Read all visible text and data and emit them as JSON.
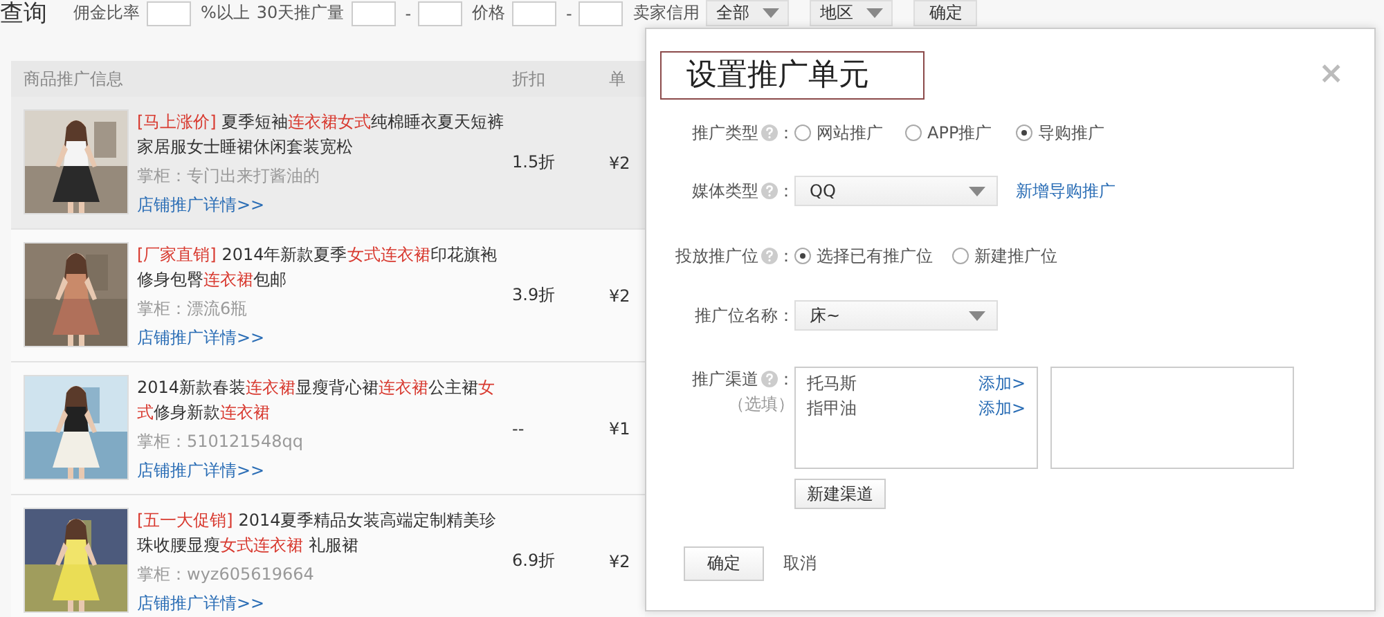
{
  "filter_bar": [
    {
      "kind": "heading",
      "text": "查询"
    },
    {
      "kind": "label",
      "text": "佣金比率"
    },
    {
      "kind": "input"
    },
    {
      "kind": "label",
      "text": "%以上"
    },
    {
      "kind": "label",
      "text": "30天推广量"
    },
    {
      "kind": "input"
    },
    {
      "kind": "label",
      "text": "-"
    },
    {
      "kind": "input"
    },
    {
      "kind": "label",
      "text": "价格"
    },
    {
      "kind": "input"
    },
    {
      "kind": "label",
      "text": "-"
    },
    {
      "kind": "input"
    },
    {
      "kind": "label",
      "text": "卖家信用"
    },
    {
      "kind": "dropdown",
      "value": "全部"
    },
    {
      "kind": "dropdown",
      "value": "地区"
    },
    {
      "kind": "button",
      "text": "确定"
    }
  ],
  "table": {
    "columns": [
      "商品推广信息",
      "折扣",
      "单"
    ],
    "rows": [
      {
        "highlighted": true,
        "tag": "[马上涨价]",
        "title": [
          {
            "text": "夏季短袖",
            "highlight": false
          },
          {
            "text": "连衣裙女式",
            "highlight": true
          },
          {
            "text": "纯棉睡衣夏天短裤家居服女士睡裙休闲套装宽松",
            "highlight": false
          }
        ],
        "shopkeeper": "掌柜：专门出来打酱油的",
        "link": "店铺推广详情>>",
        "discount": "1.5折",
        "price": "¥2"
      },
      {
        "highlighted": false,
        "tag": "[厂家直销]",
        "title": [
          {
            "text": "2014年新款夏季",
            "highlight": false
          },
          {
            "text": "女式连衣裙",
            "highlight": true
          },
          {
            "text": "印花旗袍修身包臀",
            "highlight": false
          },
          {
            "text": "连衣裙",
            "highlight": true
          },
          {
            "text": "包邮",
            "highlight": false
          }
        ],
        "shopkeeper": "掌柜：漂流6瓶",
        "link": "店铺推广详情>>",
        "discount": "3.9折",
        "price": "¥2"
      },
      {
        "highlighted": false,
        "title": [
          {
            "text": "2014新款春装",
            "highlight": false
          },
          {
            "text": "连衣裙",
            "highlight": true
          },
          {
            "text": "显瘦背心裙",
            "highlight": false
          },
          {
            "text": "连衣裙",
            "highlight": true
          },
          {
            "text": "公主裙",
            "highlight": false
          },
          {
            "text": "女式",
            "highlight": true
          },
          {
            "text": "修身新款",
            "highlight": false
          },
          {
            "text": "连衣裙",
            "highlight": true
          }
        ],
        "shopkeeper": "掌柜：510121548qq",
        "link": "店铺推广详情>>",
        "discount": "--",
        "price": "¥1"
      },
      {
        "highlighted": false,
        "tag": "[五一大促销]",
        "title": [
          {
            "text": "2014夏季精品女装高端定制精美珍珠收腰显瘦",
            "highlight": false
          },
          {
            "text": "女式连衣裙",
            "highlight": true
          },
          {
            "text": " 礼服裙",
            "highlight": false
          }
        ],
        "shopkeeper": "掌柜：wyz605619664",
        "link": "店铺推广详情>>",
        "discount": "6.9折",
        "price": "¥2"
      }
    ]
  },
  "dialog": {
    "title": "设置推广单元",
    "close": "×",
    "fields": [
      {
        "kind": "radio",
        "label": "推广类型",
        "help": true,
        "suffix": "：",
        "options": [
          {
            "label": "网站推广",
            "selected": false
          },
          {
            "label": "APP推广",
            "selected": false
          },
          {
            "label": "导购推广",
            "selected": true
          }
        ]
      },
      {
        "kind": "select",
        "label": "媒体类型",
        "help": true,
        "suffix": "：",
        "value": "QQ",
        "link": "新增导购推广"
      },
      {
        "kind": "radio",
        "label": "投放推广位",
        "help": true,
        "suffix": "：",
        "options": [
          {
            "label": "选择已有推广位",
            "selected": true
          },
          {
            "label": "新建推广位",
            "selected": false
          }
        ]
      },
      {
        "kind": "select",
        "label": "推广位名称",
        "help": false,
        "suffix": "：",
        "value": "床~"
      },
      {
        "kind": "channels",
        "label": "推广渠道",
        "help": true,
        "suffix": "：",
        "note": "（选填）",
        "items": [
          {
            "name": "托马斯",
            "action": "添加>"
          },
          {
            "name": "指甲油",
            "action": "添加>"
          }
        ],
        "button": "新建渠道"
      }
    ],
    "confirm": "确定",
    "cancel": "取消"
  }
}
